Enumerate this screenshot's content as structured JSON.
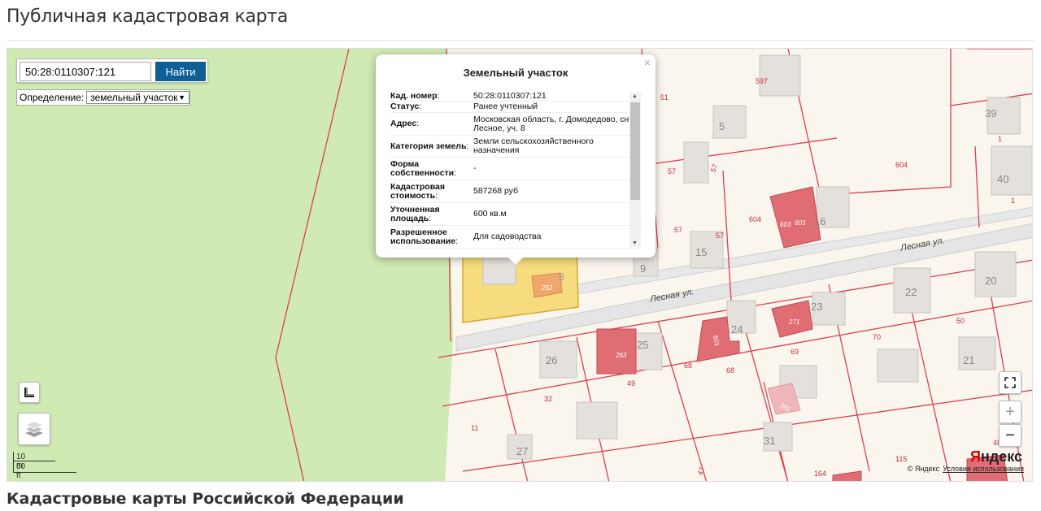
{
  "page": {
    "title": "Публичная кадастровая карта",
    "footer_heading": "Кадастровые карты Российской Федерации"
  },
  "search": {
    "value": "50:28:0110307:121",
    "button_label": "Найти"
  },
  "definition": {
    "label": "Определение:",
    "selected": "земельный участок"
  },
  "popup": {
    "title": "Земельный участок",
    "close_label": "×",
    "properties": [
      {
        "key": "Кад. номер",
        "value": "50:28:0110307:121"
      },
      {
        "key": "Статус",
        "value": "Ранее учтенный"
      },
      {
        "key": "Адрес",
        "value": "Московская область, г. Домодедово, снт Лесное, уч. 8"
      },
      {
        "key": "Категория земель",
        "value": "Земли сельскохозяйственного назначения"
      },
      {
        "key": "Форма собственности",
        "value": "-"
      },
      {
        "key": "Кадастровая стоимость",
        "value": "587268 руб"
      },
      {
        "key": "Уточненная площадь",
        "value": "600 кв.м"
      },
      {
        "key": "Разрешенное использование",
        "value": "Для садоводства"
      }
    ]
  },
  "map_labels": {
    "street_1": "Лесная ул.",
    "street_2": "Лесная ул.",
    "parcels": [
      "597",
      "51",
      "39",
      "1",
      "5",
      "604",
      "40",
      "1",
      "57",
      "57",
      "604",
      "603",
      "603",
      "16",
      "57",
      "57",
      "15",
      "9",
      "8",
      "252",
      "22",
      "20",
      "23",
      "271",
      "24",
      "601",
      "25",
      "263",
      "26",
      "69",
      "70",
      "50",
      "21",
      "68",
      "68",
      "49",
      "32",
      "281",
      "11",
      "27",
      "31",
      "48",
      "115",
      "164",
      "47"
    ]
  },
  "scale": {
    "metric": "10 m",
    "imperial": "50 ft"
  },
  "attribution": {
    "copyright": "© Яндекс",
    "terms_link": "Условия использования",
    "logo_prefix": "Я",
    "logo_rest": "ндекс"
  },
  "colors": {
    "forest": "#cfeab2",
    "land": "#faf6ee",
    "parcel_border": "#d9414d",
    "building_red": "#e06d74",
    "highlight": "#f6dc7e",
    "button": "#0f5f97"
  },
  "icons": {
    "ruler": "ruler-icon",
    "layers": "layers-icon",
    "fullscreen": "fullscreen-icon",
    "zoom_in": "zoom-in-icon",
    "zoom_out": "zoom-out-icon"
  }
}
